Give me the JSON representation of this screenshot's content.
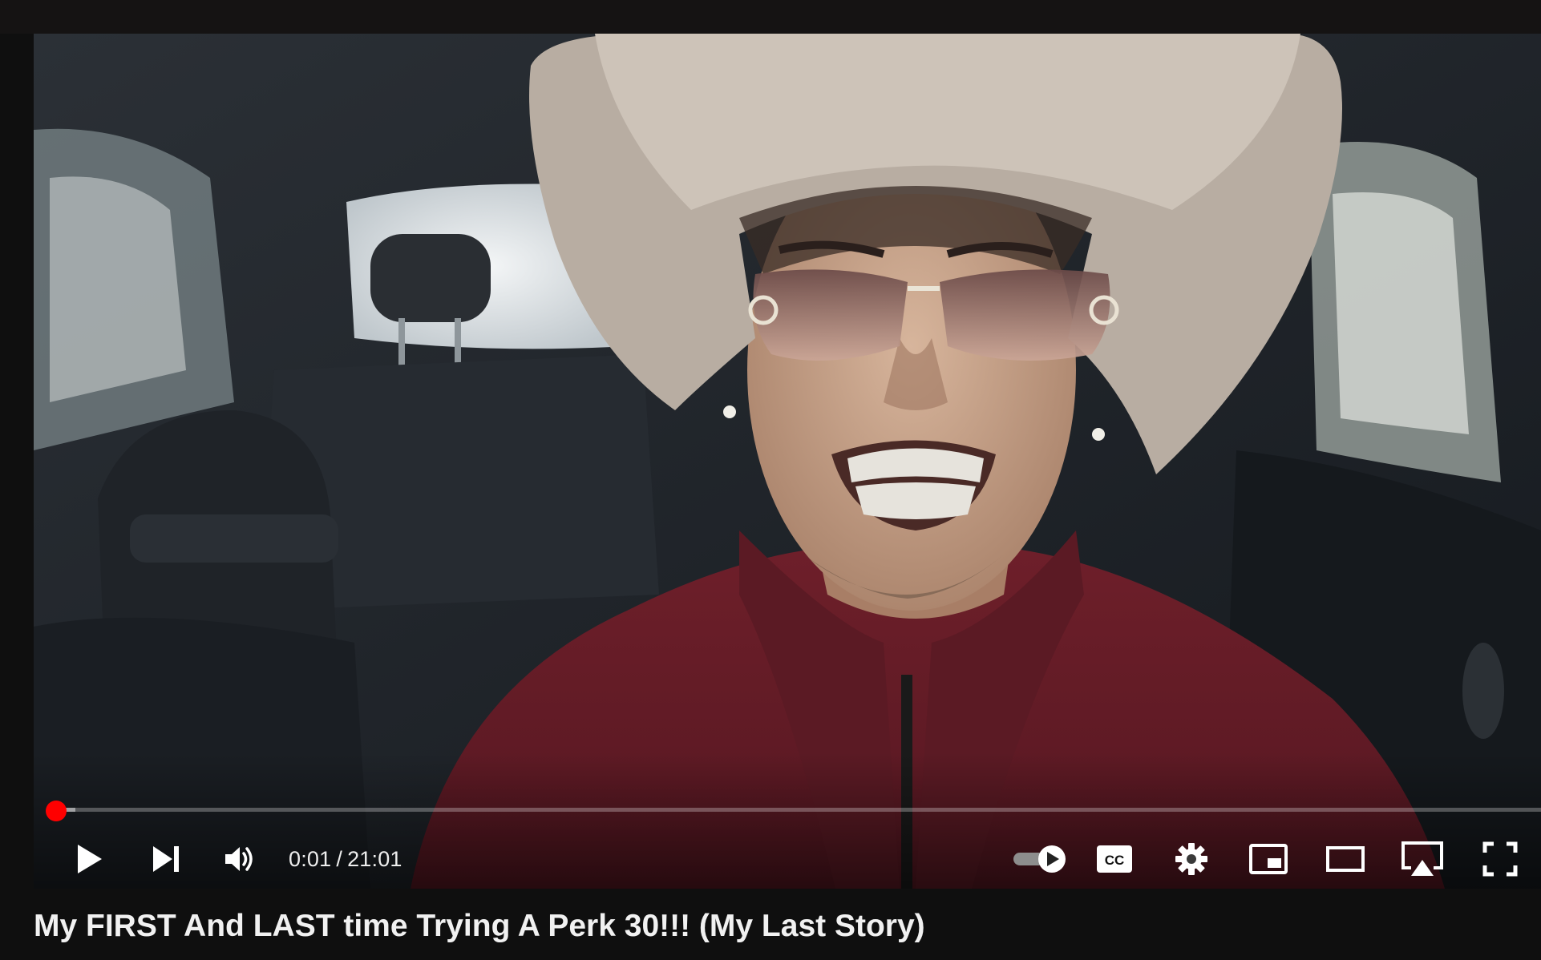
{
  "player": {
    "progress": {
      "current": "0:01",
      "duration": "21:01",
      "played_fraction": 0.0008,
      "loaded_fraction": 0.014
    },
    "controls": {
      "play_icon": "play-icon",
      "next_icon": "next-track-icon",
      "volume_icon": "volume-high-icon",
      "autoplay_icon": "autoplay-toggle-icon",
      "captions_label": "CC",
      "settings_icon": "gear-icon",
      "miniplayer_icon": "miniplayer-icon",
      "theater_icon": "theater-mode-icon",
      "airplay_icon": "airplay-icon",
      "fullscreen_icon": "fullscreen-icon"
    },
    "colors": {
      "progress_played": "#ff0000",
      "controls": "#ffffff"
    }
  },
  "video": {
    "title": "My FIRST And LAST time Trying A Perk 30!!! (My Last Story)"
  }
}
